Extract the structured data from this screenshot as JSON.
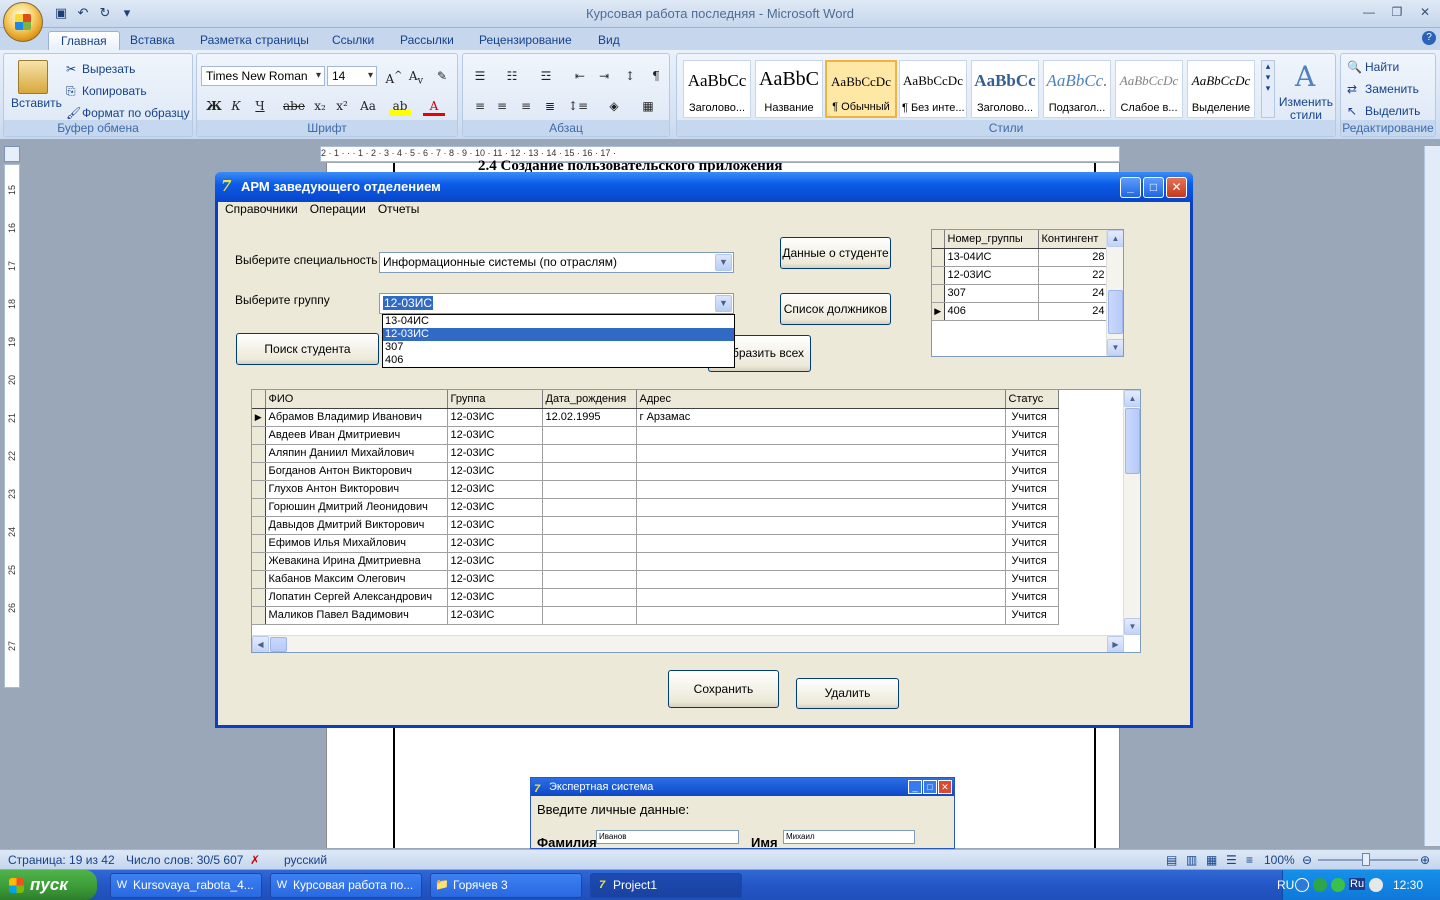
{
  "word": {
    "title": "Курсовая работа последняя - Microsoft Word",
    "tabs": [
      "Главная",
      "Вставка",
      "Разметка страницы",
      "Ссылки",
      "Рассылки",
      "Рецензирование",
      "Вид"
    ],
    "clipboard": {
      "paste": "Вставить",
      "cut": "Вырезать",
      "copy": "Копировать",
      "format_painter": "Формат по образцу",
      "group": "Буфер обмена"
    },
    "font": {
      "name": "Times New Roman",
      "size": "14",
      "group": "Шрифт"
    },
    "paragraph_group": "Абзац",
    "styles": [
      {
        "sample": "AaBbCc",
        "name": "Заголово..."
      },
      {
        "sample": "AaBbC",
        "name": "Название"
      },
      {
        "sample": "AaBbCcDc",
        "name": "¶ Обычный"
      },
      {
        "sample": "AaBbCcDc",
        "name": "¶ Без инте..."
      },
      {
        "sample": "AaBbCc",
        "name": "Заголово..."
      },
      {
        "sample": "AaBbCc.",
        "name": "Подзагол..."
      },
      {
        "sample": "AaBbCcDc",
        "name": "Слабое в..."
      },
      {
        "sample": "AaBbCcDc",
        "name": "Выделение"
      }
    ],
    "change_styles": "Изменить стили",
    "styles_group": "Стили",
    "editing": {
      "find": "Найти",
      "replace": "Заменить",
      "select": "Выделить",
      "group": "Редактирование"
    },
    "doc_heading": "2.4  Создание пользовательского приложения",
    "ruler_numbers": "2 · 1 · · · 1 · 2 · 3 · 4 · 5 · 6 · 7 · 8 · 9 · 10 · 11 · 12 · 13 · 14 · 15 · 16 · 17 · ",
    "vruler": [
      "15",
      "16",
      "17",
      "18",
      "19",
      "20",
      "21",
      "22",
      "23",
      "24",
      "25",
      "26",
      "27"
    ]
  },
  "app": {
    "title": "АРМ заведующего отделением",
    "menu": [
      "Справочники",
      "Операции",
      "Отчеты"
    ],
    "specialty_label": "Выберите специальность",
    "specialty_value": "Информационные системы (по отраслям)",
    "group_label": "Выберите группу",
    "group_value": "12-03ИС",
    "group_options": [
      "13-04ИС",
      "12-03ИС",
      "307",
      "406"
    ],
    "buttons": {
      "student_data": "Данные о студенте",
      "staff_list": "Список должников",
      "find_student": "Поиск студента",
      "show_all": "Отобразить всех",
      "save": "Сохранить",
      "delete": "Удалить"
    },
    "groups_grid": {
      "headers": [
        "Номер_группы",
        "Контингент"
      ],
      "rows": [
        [
          "13-04ИС",
          "28"
        ],
        [
          "12-03ИС",
          "22"
        ],
        [
          "307",
          "24"
        ],
        [
          "406",
          "24"
        ]
      ]
    },
    "students_grid": {
      "headers": [
        "ФИО",
        "Группа",
        "Дата_рождения",
        "Адрес",
        "Статус"
      ],
      "rows": [
        [
          "Абрамов Владимир Иванович",
          "12-03ИС",
          "12.02.1995",
          "г Арзамас",
          "Учится"
        ],
        [
          "Авдеев Иван Дмитриевич",
          "12-03ИС",
          "",
          "",
          "Учится"
        ],
        [
          "Аляпин Даниил Михайлович",
          "12-03ИС",
          "",
          "",
          "Учится"
        ],
        [
          "Богданов Антон Викторович",
          "12-03ИС",
          "",
          "",
          "Учится"
        ],
        [
          "Глухов Антон Викторович",
          "12-03ИС",
          "",
          "",
          "Учится"
        ],
        [
          "Горюшин Дмитрий Леонидович",
          "12-03ИС",
          "",
          "",
          "Учится"
        ],
        [
          "Давыдов Дмитрий Викторович",
          "12-03ИС",
          "",
          "",
          "Учится"
        ],
        [
          "Ефимов Илья Михайлович",
          "12-03ИС",
          "",
          "",
          "Учится"
        ],
        [
          "Жевакина Ирина Дмитриевна",
          "12-03ИС",
          "",
          "",
          "Учится"
        ],
        [
          "Кабанов Максим Олегович",
          "12-03ИС",
          "",
          "",
          "Учится"
        ],
        [
          "Лопатин Сергей Александрович",
          "12-03ИС",
          "",
          "",
          "Учится"
        ],
        [
          "Маликов Павел Вадимович",
          "12-03ИС",
          "",
          "",
          "Учится"
        ]
      ]
    }
  },
  "embedded": {
    "title": "Экспертная система",
    "prompt": "Введите личные данные:",
    "surname_label": "Фамилия",
    "surname_value": "Иванов",
    "name_label": "Имя",
    "name_value": "Михаил"
  },
  "status": {
    "page": "Страница: 19 из 42",
    "words": "Число слов: 30/5 607",
    "lang": "русский",
    "zoom": "100%"
  },
  "taskbar": {
    "start": "пуск",
    "tasks": [
      "Kursovaya_rabota_4...",
      "Курсовая работа по...",
      "Горячев 3",
      "Project1"
    ],
    "lang": "RU",
    "time": "12:30"
  }
}
